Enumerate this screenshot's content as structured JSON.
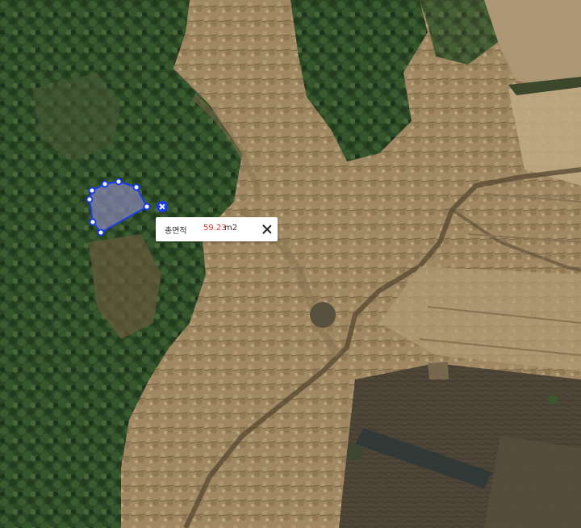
{
  "map": {
    "view": "satellite",
    "colors": {
      "forest": "#2b4a24",
      "dry_grass": "#a8906a",
      "farmland": "#4f4636",
      "measure_stroke": "#1a3de8",
      "measure_fill": "#8a86b8"
    }
  },
  "area_measurement": {
    "label": "총면적",
    "value": "59.23",
    "unit": "m2",
    "close_icon": "close-icon",
    "delete_icon": "close-icon",
    "value_color": "#d83a2c"
  }
}
